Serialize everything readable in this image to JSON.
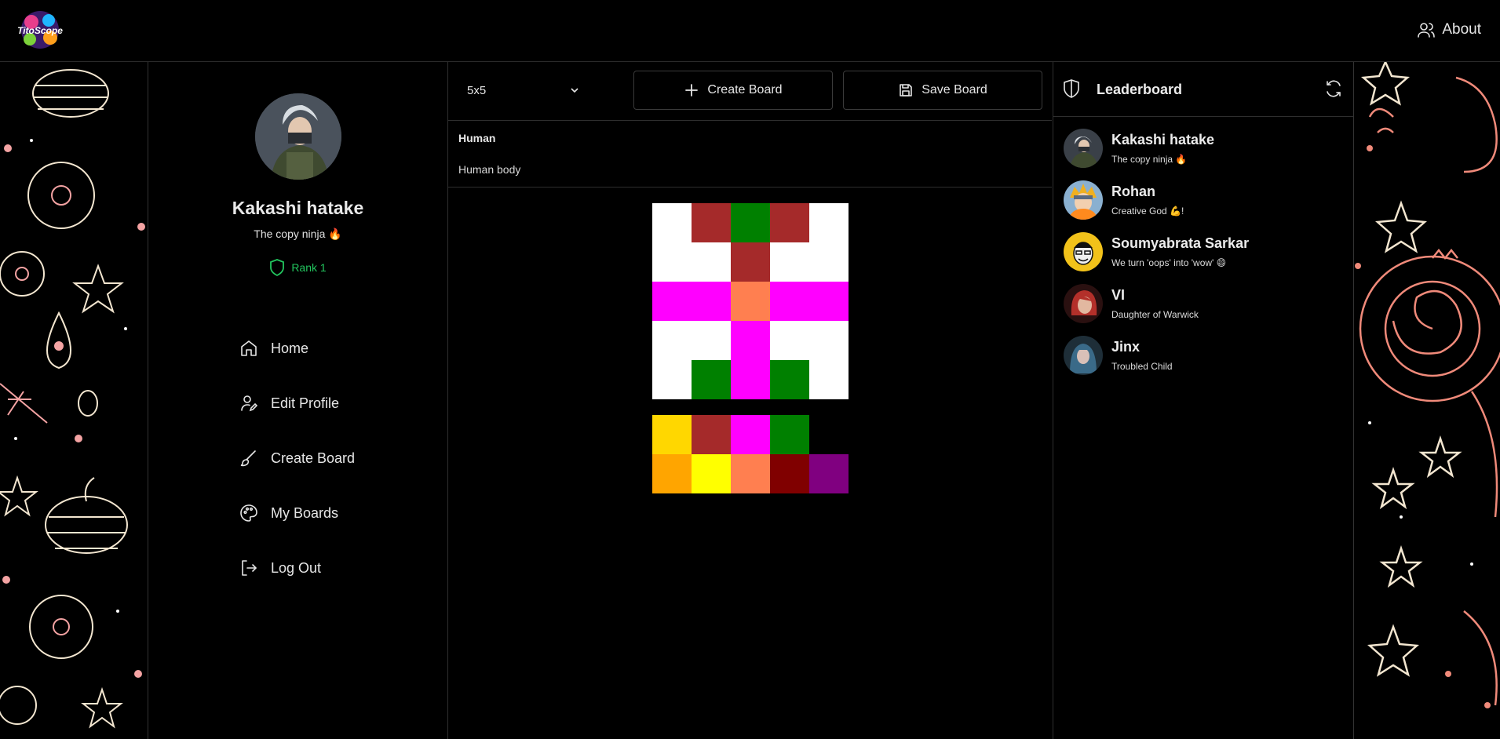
{
  "header": {
    "logo_text": "TitoScope",
    "about_label": "About"
  },
  "profile": {
    "name": "Kakashi hatake",
    "bio": "The copy ninja 🔥",
    "rank": "Rank 1"
  },
  "nav": {
    "items": [
      {
        "label": "Home",
        "icon": "home-icon"
      },
      {
        "label": "Edit Profile",
        "icon": "user-pen-icon"
      },
      {
        "label": "Create Board",
        "icon": "brush-icon"
      },
      {
        "label": "My Boards",
        "icon": "palette-icon"
      },
      {
        "label": "Log Out",
        "icon": "logout-icon"
      }
    ]
  },
  "board": {
    "size_selected": "5x5",
    "create_label": "Create Board",
    "save_label": "Save Board",
    "title": "Human",
    "description": "Human body",
    "grid": [
      [
        "#FFFFFF",
        "#A52A2A",
        "#008000",
        "#A52A2A",
        "#FFFFFF"
      ],
      [
        "#FFFFFF",
        "#FFFFFF",
        "#A52A2A",
        "#FFFFFF",
        "#FFFFFF"
      ],
      [
        "#FF00FF",
        "#FF00FF",
        "#FF7F50",
        "#FF00FF",
        "#FF00FF"
      ],
      [
        "#FFFFFF",
        "#FFFFFF",
        "#FF00FF",
        "#FFFFFF",
        "#FFFFFF"
      ],
      [
        "#FFFFFF",
        "#008000",
        "#FF00FF",
        "#008000",
        "#FFFFFF"
      ]
    ],
    "palette": [
      [
        "#FFD700",
        "#A52A2A",
        "#FF00FF",
        "#008000",
        null
      ],
      [
        "#FFA500",
        "#FFFF00",
        "#FF7F50",
        "#800000",
        "#800080"
      ]
    ]
  },
  "leaderboard": {
    "title": "Leaderboard",
    "entries": [
      {
        "name": "Kakashi hatake",
        "bio": "The copy ninja 🔥",
        "avatar_color": "#3a4048"
      },
      {
        "name": "Rohan",
        "bio": "Creative God 💪!",
        "avatar_color": "#d89a3a"
      },
      {
        "name": "Soumyabrata Sarkar",
        "bio": "We turn 'oops' into 'wow' 😄",
        "avatar_color": "#f2c21a"
      },
      {
        "name": "VI",
        "bio": "Daughter of Warwick",
        "avatar_color": "#8a2b2b"
      },
      {
        "name": "Jinx",
        "bio": "Troubled Child",
        "avatar_color": "#2c4a5a"
      }
    ]
  }
}
